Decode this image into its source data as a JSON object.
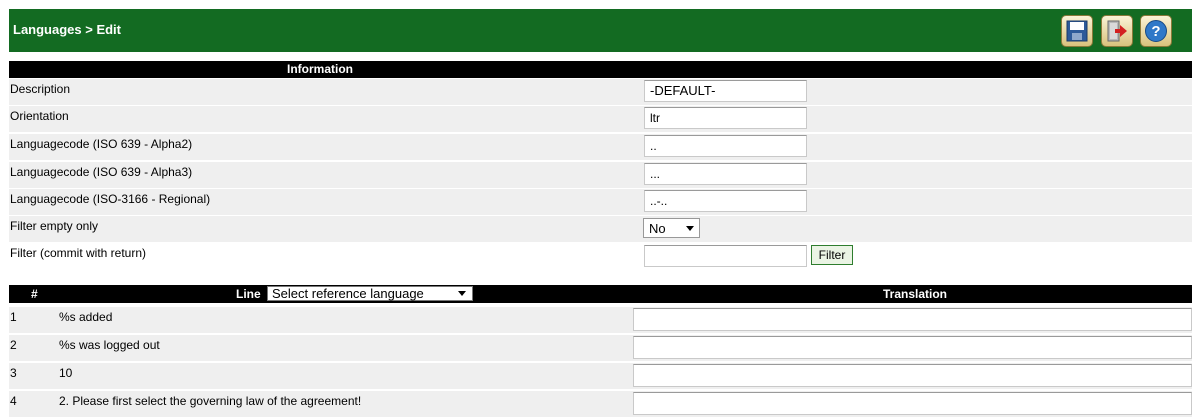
{
  "header": {
    "title": "Languages > Edit",
    "save_icon": "save-icon",
    "exit_icon": "exit-icon",
    "help_icon": "help-icon"
  },
  "info": {
    "section_title": "Information",
    "description": {
      "label": "Description",
      "value": "-DEFAULT-"
    },
    "orientation": {
      "label": "Orientation",
      "value": "ltr"
    },
    "alpha2": {
      "label": "Languagecode (ISO 639 - Alpha2)",
      "value": ".."
    },
    "alpha3": {
      "label": "Languagecode (ISO 639 - Alpha3)",
      "value": "..."
    },
    "regional": {
      "label": "Languagecode (ISO-3166 - Regional)",
      "value": "..-.."
    },
    "filter_empty": {
      "label": "Filter empty only",
      "value": "No"
    },
    "filter": {
      "label": "Filter (commit with return)",
      "value": "",
      "button": "Filter"
    }
  },
  "table": {
    "col_num": "#",
    "col_line": "Line",
    "reference_select": "Select reference language",
    "col_translation": "Translation",
    "rows": [
      {
        "num": "1",
        "text": "%s added"
      },
      {
        "num": "2",
        "text": "%s was logged out"
      },
      {
        "num": "3",
        "text": "10"
      },
      {
        "num": "4",
        "text": "2. Please first select the governing law of the agreement!"
      }
    ]
  }
}
